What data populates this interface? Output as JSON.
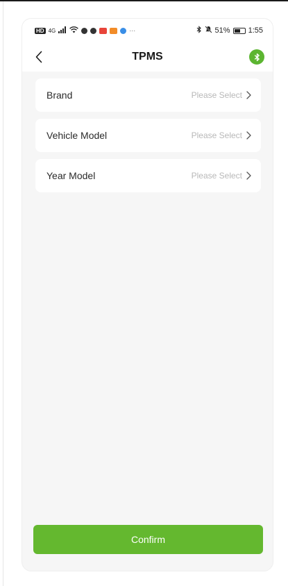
{
  "status_bar": {
    "left_label": "HD",
    "signal": "4G",
    "overflow": "···",
    "battery": "51%",
    "time": "1:55"
  },
  "nav": {
    "title": "TPMS"
  },
  "rows": [
    {
      "label": "Brand",
      "value": "Please Select"
    },
    {
      "label": "Vehicle Model",
      "value": "Please Select"
    },
    {
      "label": "Year Model",
      "value": "Please Select"
    }
  ],
  "confirm_label": "Confirm",
  "colors": {
    "accent": "#64b82f",
    "background": "#f6f6f6",
    "placeholder_text": "#b8b8b8"
  },
  "icons": [
    "back-icon",
    "bluetooth-icon",
    "chevron-right-icon"
  ]
}
